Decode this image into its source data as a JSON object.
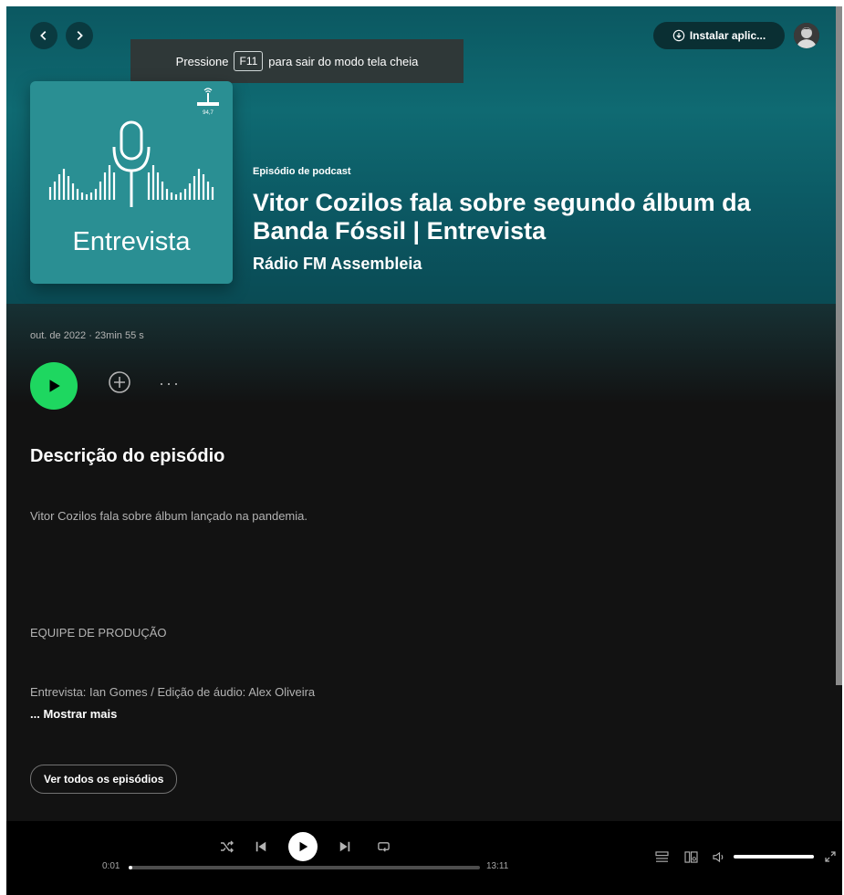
{
  "top_bar": {
    "install_label": "Instalar aplic..."
  },
  "fullscreen_notice": {
    "before": "Pressione",
    "key": "F11",
    "after": "para sair do modo tela cheia"
  },
  "cover": {
    "title": "Entrevista",
    "badge_text": "94,7"
  },
  "episode": {
    "type": "Episódio de podcast",
    "title": "Vitor Cozilos fala sobre segundo álbum da Banda Fóssil | Entrevista",
    "show": "Rádio FM Assembleia",
    "meta": "out. de 2022 · 23min 55 s"
  },
  "description": {
    "heading": "Descrição do episódio",
    "summary": "Vitor Cozilos fala sobre álbum lançado na pandemia.",
    "crew_heading": "EQUIPE DE PRODUÇÃO",
    "crew": "Entrevista: Ian Gomes / Edição de áudio: Alex Oliveira",
    "show_more": "... Mostrar mais",
    "all_episodes": "Ver todos os episódios"
  },
  "player": {
    "elapsed": "0:01",
    "duration": "13:11",
    "progress_fraction": 0.002,
    "volume_fraction": 1.0
  },
  "colors": {
    "accent_green": "#1ed760",
    "hero_teal": "#0f6a72",
    "background": "#121212"
  },
  "icons": [
    "chevron-left-icon",
    "chevron-right-icon",
    "download-icon",
    "play-icon",
    "add-circle-icon",
    "more-icon",
    "shuffle-icon",
    "previous-icon",
    "next-icon",
    "repeat-icon",
    "queue-icon",
    "device-icon",
    "volume-icon",
    "fullscreen-icon"
  ]
}
